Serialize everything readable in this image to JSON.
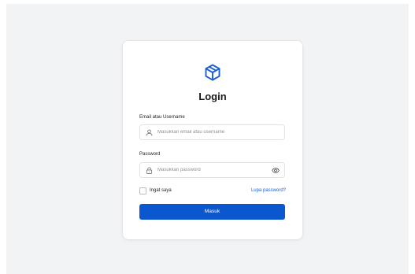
{
  "page": {
    "background": "#f2f3f5"
  },
  "login": {
    "logo_icon": "cube-icon",
    "title": "Login",
    "email_label": "Email atau Username",
    "email_placeholder": "Masukkan email atau username",
    "email_icon": "user-icon",
    "password_label": "Password",
    "password_placeholder": "Masukkan password",
    "password_icon": "lock-icon",
    "password_toggle_icon": "eye-icon",
    "remember_label": "Ingat saya",
    "remember_checked": false,
    "forgot_label": "Lupa password?",
    "submit_label": "Masuk",
    "accent_color": "#0b57d0",
    "link_color": "#1a5fd6"
  }
}
